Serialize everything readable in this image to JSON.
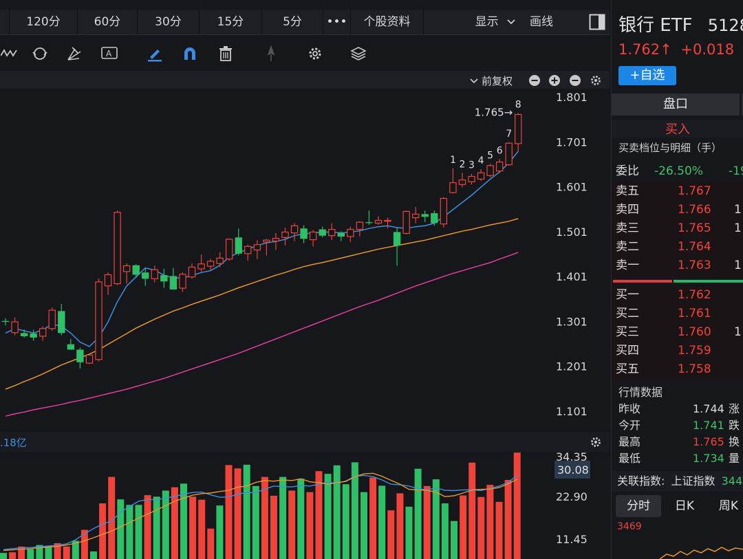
{
  "tabs": [
    "120分",
    "60分",
    "30分",
    "15分",
    "5分",
    "•••",
    "个股资料"
  ],
  "tab_right": {
    "display": "显示",
    "draw": "画线"
  },
  "chart_header": {
    "adjust": "前复权"
  },
  "stock": {
    "name": "银行 ETF",
    "code": "5128",
    "price": "1.762↑",
    "change": "+0.018",
    "change_tail": "+",
    "watch_button": "+自选"
  },
  "panel": {
    "tab_pankou": "盘口",
    "buy_label": "买入",
    "section_title": "买卖档位与明细（手）",
    "weibi_label": "委比",
    "weibi_value": "-26.50%",
    "weibi_value2": "-19",
    "asks": [
      {
        "label": "卖五",
        "price": "1.767",
        "vol": ""
      },
      {
        "label": "卖四",
        "price": "1.766",
        "vol": "1"
      },
      {
        "label": "卖三",
        "price": "1.765",
        "vol": "1"
      },
      {
        "label": "卖二",
        "price": "1.764",
        "vol": ""
      },
      {
        "label": "卖一",
        "price": "1.763",
        "vol": "1"
      }
    ],
    "bids": [
      {
        "label": "买一",
        "price": "1.762",
        "vol": ""
      },
      {
        "label": "买二",
        "price": "1.761",
        "vol": ""
      },
      {
        "label": "买三",
        "price": "1.760",
        "vol": "1"
      },
      {
        "label": "买四",
        "price": "1.759",
        "vol": ""
      },
      {
        "label": "买五",
        "price": "1.758",
        "vol": ""
      }
    ],
    "market_title": "行情数据",
    "market": [
      {
        "label": "昨收",
        "value": "1.744",
        "tail": "涨"
      },
      {
        "label": "今开",
        "value": "1.741",
        "tail": "跌"
      },
      {
        "label": "最高",
        "value": "1.765",
        "tail": "换"
      },
      {
        "label": "最低",
        "value": "1.734",
        "tail": "量"
      }
    ],
    "index_label": "关联指数:",
    "index_name": "上证指数",
    "index_value": "344",
    "tabs2": [
      "分时",
      "日K",
      "周K"
    ],
    "mini_value": "3469"
  },
  "colors": {
    "up": "#f0433a",
    "down": "#2fbf66",
    "ma_blue": "#3d8fe0",
    "ma_orange": "#e8962e",
    "ma_pink": "#e23fa0"
  },
  "icons": [
    "wave-icon",
    "refresh-icon",
    "fork-icon",
    "text-icon",
    "pen-icon",
    "magnet-icon",
    "trash-icon",
    "pin-icon",
    "gear-icon",
    "layers-icon"
  ],
  "chart_data": [
    {
      "type": "candlestick",
      "y_ticks": [
        "1.801",
        "1.701",
        "1.601",
        "1.501",
        "1.401",
        "1.301",
        "1.201",
        "1.101"
      ],
      "ylim": [
        1.101,
        1.801
      ],
      "candles": [
        {
          "o": 1.302,
          "h": 1.308,
          "l": 1.292,
          "c": 1.3
        },
        {
          "o": 1.276,
          "h": 1.31,
          "l": 1.27,
          "c": 1.3
        },
        {
          "o": 1.275,
          "h": 1.283,
          "l": 1.265,
          "c": 1.268
        },
        {
          "o": 1.274,
          "h": 1.282,
          "l": 1.258,
          "c": 1.265
        },
        {
          "o": 1.268,
          "h": 1.29,
          "l": 1.258,
          "c": 1.285
        },
        {
          "o": 1.285,
          "h": 1.332,
          "l": 1.28,
          "c": 1.326
        },
        {
          "o": 1.324,
          "h": 1.34,
          "l": 1.27,
          "c": 1.275
        },
        {
          "o": 1.25,
          "h": 1.262,
          "l": 1.24,
          "c": 1.238
        },
        {
          "o": 1.238,
          "h": 1.242,
          "l": 1.196,
          "c": 1.21
        },
        {
          "o": 1.208,
          "h": 1.228,
          "l": 1.206,
          "c": 1.226
        },
        {
          "o": 1.216,
          "h": 1.396,
          "l": 1.212,
          "c": 1.389
        },
        {
          "o": 1.38,
          "h": 1.41,
          "l": 1.36,
          "c": 1.405
        },
        {
          "o": 1.385,
          "h": 1.548,
          "l": 1.382,
          "c": 1.544
        },
        {
          "o": 1.412,
          "h": 1.43,
          "l": 1.385,
          "c": 1.425
        },
        {
          "o": 1.426,
          "h": 1.428,
          "l": 1.398,
          "c": 1.405
        },
        {
          "o": 1.41,
          "h": 1.42,
          "l": 1.38,
          "c": 1.396
        },
        {
          "o": 1.396,
          "h": 1.425,
          "l": 1.388,
          "c": 1.416
        },
        {
          "o": 1.404,
          "h": 1.418,
          "l": 1.376,
          "c": 1.39
        },
        {
          "o": 1.402,
          "h": 1.42,
          "l": 1.375,
          "c": 1.372
        },
        {
          "o": 1.375,
          "h": 1.41,
          "l": 1.367,
          "c": 1.406
        },
        {
          "o": 1.4,
          "h": 1.43,
          "l": 1.396,
          "c": 1.422
        },
        {
          "o": 1.418,
          "h": 1.45,
          "l": 1.412,
          "c": 1.429
        },
        {
          "o": 1.424,
          "h": 1.44,
          "l": 1.414,
          "c": 1.435
        },
        {
          "o": 1.43,
          "h": 1.455,
          "l": 1.422,
          "c": 1.442
        },
        {
          "o": 1.44,
          "h": 1.486,
          "l": 1.436,
          "c": 1.484
        },
        {
          "o": 1.488,
          "h": 1.508,
          "l": 1.448,
          "c": 1.452
        },
        {
          "o": 1.452,
          "h": 1.472,
          "l": 1.436,
          "c": 1.468
        },
        {
          "o": 1.46,
          "h": 1.482,
          "l": 1.44,
          "c": 1.472
        },
        {
          "o": 1.478,
          "h": 1.485,
          "l": 1.448,
          "c": 1.482
        },
        {
          "o": 1.48,
          "h": 1.498,
          "l": 1.46,
          "c": 1.486
        },
        {
          "o": 1.488,
          "h": 1.51,
          "l": 1.47,
          "c": 1.5
        },
        {
          "o": 1.498,
          "h": 1.52,
          "l": 1.48,
          "c": 1.514
        },
        {
          "o": 1.508,
          "h": 1.515,
          "l": 1.475,
          "c": 1.485
        },
        {
          "o": 1.483,
          "h": 1.505,
          "l": 1.468,
          "c": 1.5
        },
        {
          "o": 1.506,
          "h": 1.512,
          "l": 1.488,
          "c": 1.492
        },
        {
          "o": 1.492,
          "h": 1.52,
          "l": 1.482,
          "c": 1.506
        },
        {
          "o": 1.498,
          "h": 1.502,
          "l": 1.48,
          "c": 1.49
        },
        {
          "o": 1.49,
          "h": 1.512,
          "l": 1.478,
          "c": 1.506
        },
        {
          "o": 1.506,
          "h": 1.524,
          "l": 1.49,
          "c": 1.522
        },
        {
          "o": 1.522,
          "h": 1.548,
          "l": 1.516,
          "c": 1.52
        },
        {
          "o": 1.52,
          "h": 1.535,
          "l": 1.516,
          "c": 1.526
        },
        {
          "o": 1.524,
          "h": 1.532,
          "l": 1.508,
          "c": 1.526
        },
        {
          "o": 1.5,
          "h": 1.51,
          "l": 1.425,
          "c": 1.47
        },
        {
          "o": 1.497,
          "h": 1.548,
          "l": 1.495,
          "c": 1.546
        },
        {
          "o": 1.532,
          "h": 1.556,
          "l": 1.52,
          "c": 1.54
        },
        {
          "o": 1.54,
          "h": 1.548,
          "l": 1.522,
          "c": 1.534
        },
        {
          "o": 1.542,
          "h": 1.548,
          "l": 1.514,
          "c": 1.52
        },
        {
          "o": 1.518,
          "h": 1.578,
          "l": 1.51,
          "c": 1.575
        },
        {
          "o": 1.588,
          "h": 1.642,
          "l": 1.586,
          "c": 1.61
        },
        {
          "o": 1.606,
          "h": 1.632,
          "l": 1.6,
          "c": 1.616
        },
        {
          "o": 1.612,
          "h": 1.63,
          "l": 1.606,
          "c": 1.624
        },
        {
          "o": 1.618,
          "h": 1.64,
          "l": 1.614,
          "c": 1.632
        },
        {
          "o": 1.626,
          "h": 1.652,
          "l": 1.622,
          "c": 1.648
        },
        {
          "o": 1.636,
          "h": 1.662,
          "l": 1.632,
          "c": 1.656
        },
        {
          "o": 1.65,
          "h": 1.7,
          "l": 1.648,
          "c": 1.698
        },
        {
          "o": 1.697,
          "h": 1.765,
          "l": 1.68,
          "c": 1.762
        }
      ],
      "ma": [
        {
          "name": "MA5",
          "color": "#3d8fe0",
          "values": [
            1.275,
            1.285,
            1.28,
            1.275,
            1.282,
            1.295,
            1.29,
            1.275,
            1.255,
            1.245,
            1.265,
            1.3,
            1.345,
            1.38,
            1.4,
            1.42,
            1.415,
            1.404,
            1.398,
            1.398,
            1.403,
            1.41,
            1.414,
            1.426,
            1.444,
            1.454,
            1.462,
            1.47,
            1.476,
            1.479,
            1.484,
            1.492,
            1.496,
            1.498,
            1.5,
            1.5,
            1.498,
            1.5,
            1.503,
            1.508,
            1.512,
            1.514,
            1.51,
            1.508,
            1.512,
            1.514,
            1.52,
            1.534,
            1.55,
            1.566,
            1.582,
            1.6,
            1.618,
            1.634,
            1.654,
            1.68
          ]
        },
        {
          "name": "MA10",
          "color": "#e8962e",
          "values": [
            1.15,
            1.158,
            1.167,
            1.175,
            1.184,
            1.194,
            1.204,
            1.212,
            1.22,
            1.228,
            1.238,
            1.25,
            1.262,
            1.274,
            1.286,
            1.296,
            1.306,
            1.315,
            1.324,
            1.331,
            1.339,
            1.346,
            1.353,
            1.36,
            1.368,
            1.376,
            1.383,
            1.39,
            1.397,
            1.404,
            1.41,
            1.417,
            1.423,
            1.428,
            1.432,
            1.437,
            1.442,
            1.447,
            1.452,
            1.457,
            1.462,
            1.466,
            1.47,
            1.474,
            1.478,
            1.482,
            1.487,
            1.492,
            1.497,
            1.502,
            1.506,
            1.511,
            1.516,
            1.52,
            1.524,
            1.53
          ]
        },
        {
          "name": "MA20",
          "color": "#e23fa0",
          "values": [
            1.09,
            1.095,
            1.099,
            1.104,
            1.108,
            1.112,
            1.116,
            1.121,
            1.125,
            1.13,
            1.135,
            1.14,
            1.145,
            1.15,
            1.156,
            1.162,
            1.168,
            1.174,
            1.181,
            1.188,
            1.195,
            1.202,
            1.209,
            1.216,
            1.223,
            1.23,
            1.238,
            1.246,
            1.254,
            1.262,
            1.27,
            1.278,
            1.286,
            1.294,
            1.302,
            1.31,
            1.318,
            1.326,
            1.334,
            1.341,
            1.348,
            1.356,
            1.364,
            1.372,
            1.38,
            1.387,
            1.394,
            1.401,
            1.408,
            1.414,
            1.42,
            1.426,
            1.432,
            1.44,
            1.447,
            1.455
          ]
        }
      ],
      "annotations": [
        {
          "text": "1",
          "index": 48
        },
        {
          "text": "2",
          "index": 49
        },
        {
          "text": "3",
          "index": 50
        },
        {
          "text": "4",
          "index": 51
        },
        {
          "text": "5",
          "index": 52
        },
        {
          "text": "6",
          "index": 53
        },
        {
          "text": "7",
          "index": 54
        },
        {
          "text": "8",
          "index": 55
        },
        {
          "text": "1.765→",
          "index": 55
        }
      ]
    },
    {
      "type": "bar",
      "title_fragment": ".18亿",
      "y_ticks": [
        "34.35",
        "22.90",
        "11.45"
      ],
      "current_value": "30.08",
      "ylim": [
        0,
        34.35
      ],
      "bars": [
        {
          "v": 2.0,
          "up": false
        },
        {
          "v": 2.2,
          "up": true
        },
        {
          "v": 4.1,
          "up": true
        },
        {
          "v": 3.2,
          "up": false
        },
        {
          "v": 4.6,
          "up": false
        },
        {
          "v": 4.4,
          "up": false
        },
        {
          "v": 5.2,
          "up": true
        },
        {
          "v": 4.1,
          "up": true
        },
        {
          "v": 6.0,
          "up": false
        },
        {
          "v": 9.6,
          "up": true
        },
        {
          "v": 2.5,
          "up": false
        },
        {
          "v": 18.3,
          "up": true
        },
        {
          "v": 27.0,
          "up": true
        },
        {
          "v": 19.6,
          "up": false
        },
        {
          "v": 17.8,
          "up": false
        },
        {
          "v": 17.8,
          "up": false
        },
        {
          "v": 21.0,
          "up": true
        },
        {
          "v": 20.5,
          "up": false
        },
        {
          "v": 22.5,
          "up": false
        },
        {
          "v": 23.6,
          "up": true
        },
        {
          "v": 24.8,
          "up": false
        },
        {
          "v": 20.5,
          "up": true
        },
        {
          "v": 19.5,
          "up": true
        },
        {
          "v": 10.0,
          "up": true
        },
        {
          "v": 17.6,
          "up": false
        },
        {
          "v": 30.9,
          "up": true
        },
        {
          "v": 29.8,
          "up": true
        },
        {
          "v": 31.0,
          "up": false
        },
        {
          "v": 24.0,
          "up": false
        },
        {
          "v": 27.0,
          "up": true
        },
        {
          "v": 20.8,
          "up": true
        },
        {
          "v": 27.0,
          "up": false
        },
        {
          "v": 22.5,
          "up": true
        },
        {
          "v": 26.4,
          "up": false
        },
        {
          "v": 22.0,
          "up": true
        },
        {
          "v": 28.9,
          "up": true
        },
        {
          "v": 28.0,
          "up": false
        },
        {
          "v": 30.8,
          "up": false
        },
        {
          "v": 24.6,
          "up": false
        },
        {
          "v": 31.8,
          "up": false
        },
        {
          "v": 22.0,
          "up": false
        },
        {
          "v": 26.8,
          "up": true
        },
        {
          "v": 24.1,
          "up": false
        },
        {
          "v": 16.0,
          "up": true
        },
        {
          "v": 21.6,
          "up": true
        },
        {
          "v": 17.2,
          "up": false
        },
        {
          "v": 29.7,
          "up": false
        },
        {
          "v": 24.0,
          "up": true
        },
        {
          "v": 26.2,
          "up": false
        },
        {
          "v": 18.3,
          "up": false
        },
        {
          "v": 12.5,
          "up": false
        },
        {
          "v": 20.9,
          "up": true
        },
        {
          "v": 31.7,
          "up": true
        },
        {
          "v": 20.4,
          "up": true
        },
        {
          "v": 24.4,
          "up": true
        },
        {
          "v": 18.8,
          "up": true
        },
        {
          "v": 26.0,
          "up": true
        },
        {
          "v": 35.0,
          "up": true
        }
      ],
      "ma": [
        {
          "name": "VMA5",
          "color": "#3d8fe0",
          "values": [
            3.1,
            3.4,
            3.7,
            3.8,
            4.0,
            4.3,
            4.5,
            5.0,
            6.3,
            8.3,
            10.0,
            11.5,
            12.5,
            15.4,
            17.3,
            19.0,
            19.6,
            19.5,
            20.0,
            20.6,
            21.3,
            21.9,
            22.0,
            21.1,
            20.3,
            20.4,
            21.3,
            21.9,
            21.8,
            23.0,
            24.0,
            23.8,
            23.7,
            24.2,
            24.0,
            24.6,
            25.3,
            24.8,
            25.7,
            27.2,
            27.5,
            27.1,
            26.0,
            24.6,
            24.4,
            24.0,
            23.1,
            22.7,
            23.4,
            22.6,
            22.5,
            22.7,
            22.8,
            22.5,
            23.3,
            24.0,
            25.2,
            27.5
          ]
        },
        {
          "name": "VMA10",
          "color": "#e8962e",
          "values": [
            2.8,
            3.0,
            3.2,
            3.4,
            3.7,
            3.9,
            4.2,
            4.6,
            5.2,
            6.0,
            7.0,
            8.1,
            9.2,
            10.6,
            12.0,
            13.4,
            14.8,
            16.1,
            17.6,
            19.0,
            20.0,
            21.0,
            21.5,
            21.7,
            22.2,
            22.6,
            23.6,
            24.0,
            25.2,
            25.8,
            25.6,
            26.0,
            25.8,
            26.4,
            25.4,
            25.1,
            24.6,
            25.1,
            25.5,
            27.1,
            28.0,
            28.2,
            27.2,
            25.9,
            24.6,
            22.9,
            22.7,
            22.6,
            22.0,
            20.5,
            20.8,
            21.7,
            22.7,
            22.9,
            23.0,
            23.5,
            24.7,
            26.3
          ]
        }
      ]
    }
  ]
}
